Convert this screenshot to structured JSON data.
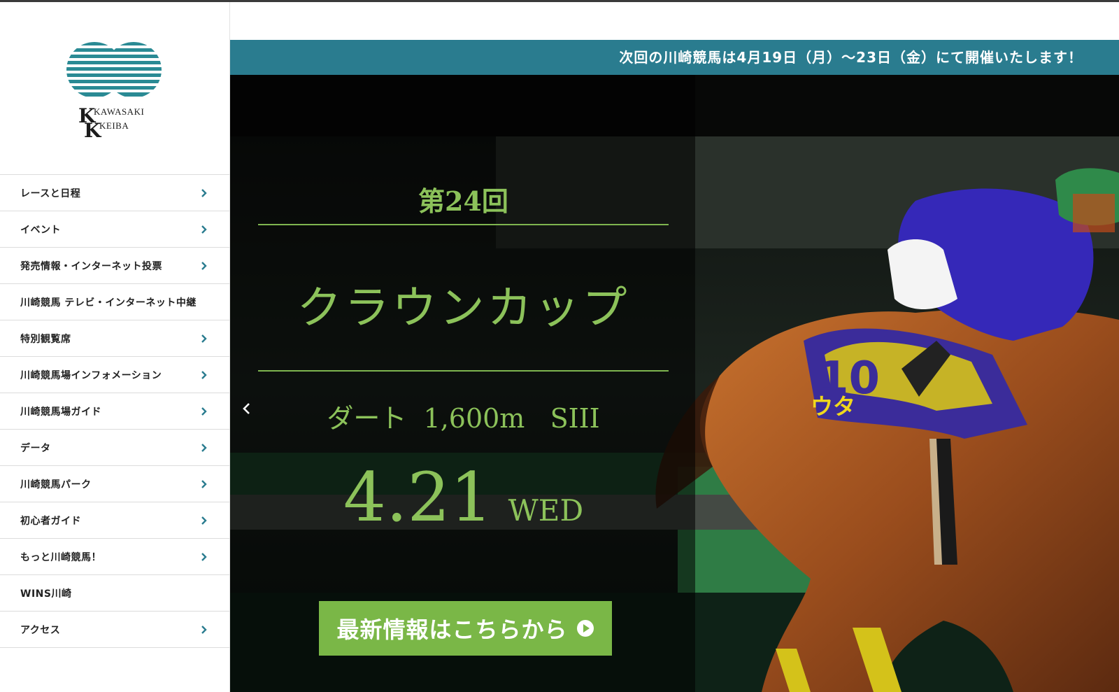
{
  "logo": {
    "line1": "KAWASAKI",
    "line2": "KEIBA"
  },
  "nav": {
    "items": [
      {
        "label": "レースと日程",
        "icon": "chevron-right-icon"
      },
      {
        "label": "イベント",
        "icon": "chevron-right-icon"
      },
      {
        "label": "発売情報・インターネット投票",
        "icon": "chevron-right-icon"
      },
      {
        "label": "川崎競馬 テレビ・インターネット中継"
      },
      {
        "label": "特別観覧席",
        "icon": "chevron-right-icon"
      },
      {
        "label": "川崎競馬場インフォメーション",
        "icon": "chevron-right-icon"
      },
      {
        "label": "川崎競馬場ガイド",
        "icon": "chevron-right-icon"
      },
      {
        "label": "データ",
        "icon": "chevron-right-icon"
      },
      {
        "label": "川崎競馬パーク",
        "icon": "chevron-right-icon"
      },
      {
        "label": "初心者ガイド",
        "icon": "chevron-right-icon"
      },
      {
        "label": "もっと川崎競馬！",
        "icon": "chevron-right-icon"
      },
      {
        "label": "WINS川崎"
      },
      {
        "label": "アクセス",
        "icon": "chevron-right-icon"
      }
    ]
  },
  "notice": {
    "text": "次回の川崎競馬は4月19日（月）〜23日（金）にて開催いたします！"
  },
  "hero": {
    "event_number": "第24回",
    "race_name": "クラウンカップ",
    "race_info": "ダート  1,600m   SIII",
    "date": "4.21",
    "weekday": "WED",
    "cta_label": "最新情報はこちらから",
    "saddle_number": "10",
    "saddle_name": "ウタ"
  },
  "colors": {
    "accent_green": "#8cc25a",
    "button_green": "#7ab747",
    "notice_teal": "#2a7c8f",
    "logo_teal": "#2a8a94"
  }
}
